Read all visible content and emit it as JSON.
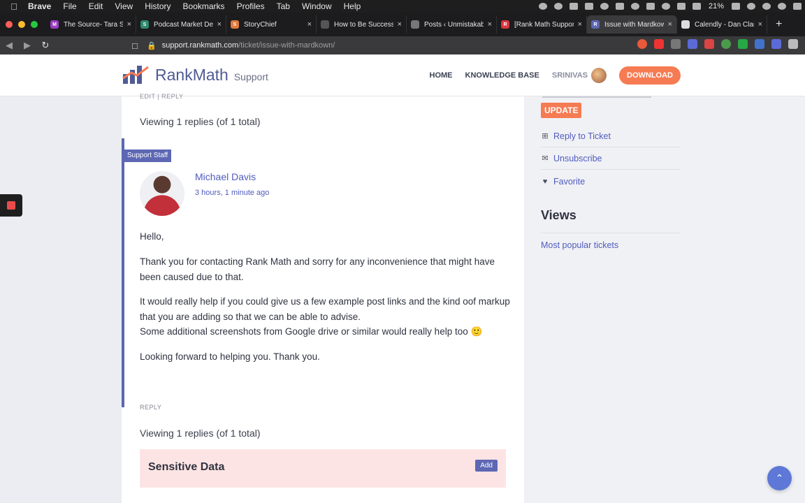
{
  "menubar": {
    "app": "Brave",
    "items": [
      "File",
      "Edit",
      "View",
      "History",
      "Bookmarks",
      "Profiles",
      "Tab",
      "Window",
      "Help"
    ],
    "battery": "21%"
  },
  "tabs": [
    {
      "title": "The Source- Tara S",
      "icon": "M",
      "color": "#9b3dc4",
      "active": false
    },
    {
      "title": "Podcast Market De",
      "icon": "S",
      "color": "#2e8b6b",
      "active": false
    },
    {
      "title": "StoryChief",
      "icon": "S",
      "color": "#e07a3a",
      "active": false
    },
    {
      "title": "How to Be Success",
      "icon": "",
      "color": "#555555",
      "active": false
    },
    {
      "title": "Posts ‹ Unmistakab",
      "icon": "",
      "color": "#777777",
      "active": false
    },
    {
      "title": "[Rank Math Suppor",
      "icon": "R",
      "color": "#d9363e",
      "active": false
    },
    {
      "title": "Issue with Mardkow",
      "icon": "R",
      "color": "#5d67b4",
      "active": true
    },
    {
      "title": "Calendly - Dan Clar",
      "icon": "",
      "color": "#dddddd",
      "active": false
    }
  ],
  "address": {
    "domain": "support.rankmath.com",
    "path": "/ticket/issue-with-mardkown/"
  },
  "header": {
    "logo_rank": "Rank",
    "logo_math": "Math",
    "logo_support": "Support",
    "nav_home": "HOME",
    "nav_kb": "KNOWLEDGE BASE",
    "nav_user": "SRINIVAS",
    "download": "DOWNLOAD"
  },
  "main": {
    "edit_reply": "EDIT  |  REPLY",
    "viewing_top": "Viewing 1 replies (of 1 total)",
    "staff_badge": "Support Staff",
    "author": "Michael Davis",
    "time": "3 hours, 1 minute ago",
    "greeting": "Hello,",
    "para1": "Thank you for contacting Rank Math and sorry for any inconvenience that might have been caused due to that.",
    "para2a": "It would really help if you could give us a few example post links and the kind oof markup that you are adding so that we can be able to advise.",
    "para2b": "Some additional screenshots from Google drive or similar would really help too 🙂",
    "para3": "Looking forward to helping you. Thank you.",
    "reply": "REPLY",
    "viewing_bottom": "Viewing 1 replies (of 1 total)",
    "sensitive_title": "Sensitive Data",
    "add": "Add"
  },
  "sidebar": {
    "update": "UPDATE",
    "links": [
      "Reply to Ticket",
      "Unsubscribe",
      "Favorite"
    ],
    "views_title": "Views",
    "popular": "Most popular tickets"
  },
  "colors": {
    "brand": "#4f5b94",
    "accent": "#f67b53",
    "link": "#4f5bbd",
    "staff": "#5d67b4"
  }
}
